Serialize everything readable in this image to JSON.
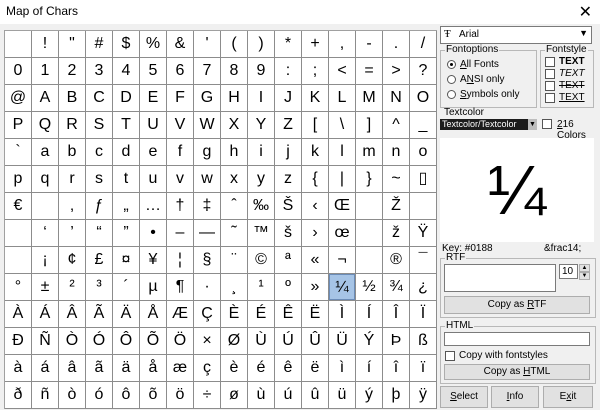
{
  "window": {
    "title": "Map of Chars",
    "close_glyph": "✕"
  },
  "grid": {
    "selected_char": "¼",
    "rows": [
      [
        "",
        "!",
        "\"",
        "#",
        "$",
        "%",
        "&",
        "'",
        "(",
        ")",
        "*",
        "+",
        ",",
        "-",
        ".",
        "/"
      ],
      [
        "0",
        "1",
        "2",
        "3",
        "4",
        "5",
        "6",
        "7",
        "8",
        "9",
        ":",
        ";",
        "<",
        "=",
        ">",
        "?"
      ],
      [
        "@",
        "A",
        "B",
        "C",
        "D",
        "E",
        "F",
        "G",
        "H",
        "I",
        "J",
        "K",
        "L",
        "M",
        "N",
        "O"
      ],
      [
        "P",
        "Q",
        "R",
        "S",
        "T",
        "U",
        "V",
        "W",
        "X",
        "Y",
        "Z",
        "[",
        "\\",
        "]",
        "^",
        "_"
      ],
      [
        "`",
        "a",
        "b",
        "c",
        "d",
        "e",
        "f",
        "g",
        "h",
        "i",
        "j",
        "k",
        "l",
        "m",
        "n",
        "o"
      ],
      [
        "p",
        "q",
        "r",
        "s",
        "t",
        "u",
        "v",
        "w",
        "x",
        "y",
        "z",
        "{",
        "|",
        "}",
        "~",
        "▯"
      ],
      [
        "€",
        "",
        "‚",
        "ƒ",
        "„",
        "…",
        "†",
        "‡",
        "ˆ",
        "‰",
        "Š",
        "‹",
        "Œ",
        "",
        "Ž",
        ""
      ],
      [
        "",
        "‘",
        "’",
        "“",
        "”",
        "•",
        "–",
        "—",
        "˜",
        "™",
        "š",
        "›",
        "œ",
        "",
        "ž",
        "Ÿ"
      ],
      [
        "",
        "¡",
        "¢",
        "£",
        "¤",
        "¥",
        "¦",
        "§",
        "¨",
        "©",
        "ª",
        "«",
        "¬",
        "­",
        "®",
        "¯"
      ],
      [
        "°",
        "±",
        "²",
        "³",
        "´",
        "µ",
        "¶",
        "·",
        "¸",
        "¹",
        "º",
        "»",
        "¼",
        "½",
        "¾",
        "¿"
      ],
      [
        "À",
        "Á",
        "Â",
        "Ã",
        "Ä",
        "Å",
        "Æ",
        "Ç",
        "È",
        "É",
        "Ê",
        "Ë",
        "Ì",
        "Í",
        "Î",
        "Ï"
      ],
      [
        "Ð",
        "Ñ",
        "Ò",
        "Ó",
        "Ô",
        "Õ",
        "Ö",
        "×",
        "Ø",
        "Ù",
        "Ú",
        "Û",
        "Ü",
        "Ý",
        "Þ",
        "ß"
      ],
      [
        "à",
        "á",
        "â",
        "ã",
        "ä",
        "å",
        "æ",
        "ç",
        "è",
        "é",
        "ê",
        "ë",
        "ì",
        "í",
        "î",
        "ï"
      ],
      [
        "ð",
        "ñ",
        "ò",
        "ó",
        "ô",
        "õ",
        "ö",
        "÷",
        "ø",
        "ù",
        "ú",
        "û",
        "ü",
        "ý",
        "þ",
        "ÿ"
      ]
    ]
  },
  "font_select": {
    "icon": "Ŧ",
    "value": "Arial",
    "arrow": "▼"
  },
  "fontoptions": {
    "label": "Fontoptions",
    "options": [
      {
        "label": "All Fonts",
        "selected": true
      },
      {
        "label": "ANSI only",
        "selected": false
      },
      {
        "label": "Symbols only",
        "selected": false
      }
    ]
  },
  "fontstyle": {
    "label": "Fontstyle",
    "options": [
      "TEXT",
      "TEXT",
      "TEXT",
      "TEXT"
    ]
  },
  "textcolor": {
    "label": "Textcolor",
    "value": "Textcolor/Textcolor",
    "dropdown_arrow": "▼",
    "colors_label": "216 Colors",
    "color": "#1c1c1c"
  },
  "preview": {
    "char": "¼"
  },
  "key_info": {
    "key": "Key:  #0188",
    "entity": "&frac14;"
  },
  "rtf": {
    "label": "RTF",
    "size_value": "10",
    "copy_label": "Copy as RTF"
  },
  "html": {
    "label": "HTML",
    "fontstyles_label": "Copy with fontstyles",
    "copy_label": "Copy as HTML"
  },
  "buttons": {
    "select": "Select",
    "info": "Info",
    "exit": "Exit"
  }
}
